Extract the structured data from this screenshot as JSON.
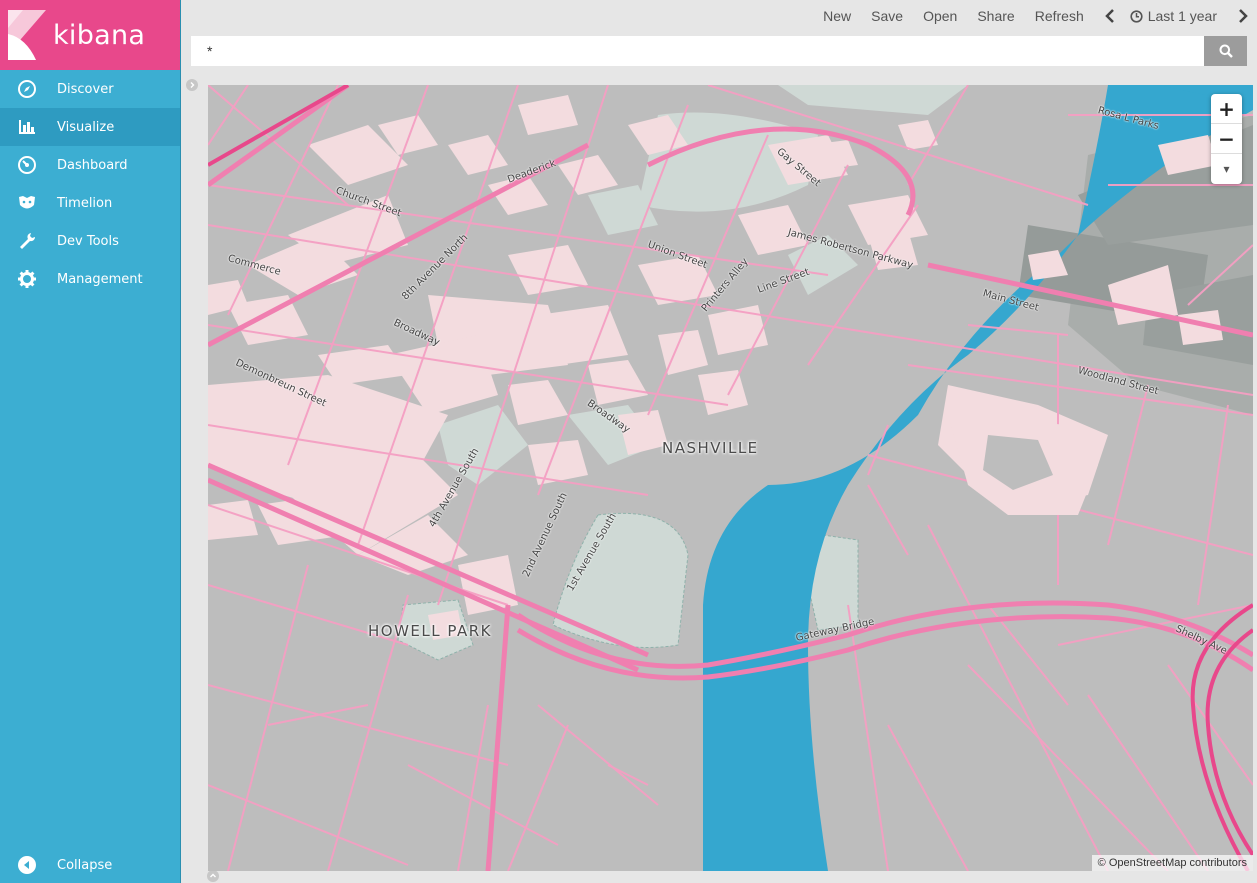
{
  "app": {
    "name": "kibana",
    "brand_color": "#e8488b",
    "sidebar_color": "#3caed2"
  },
  "sidebar": {
    "items": [
      {
        "label": "Discover",
        "icon": "compass-icon"
      },
      {
        "label": "Visualize",
        "icon": "bar-chart-icon",
        "active": true
      },
      {
        "label": "Dashboard",
        "icon": "speedometer-icon"
      },
      {
        "label": "Timelion",
        "icon": "timelion-icon"
      },
      {
        "label": "Dev Tools",
        "icon": "wrench-icon"
      },
      {
        "label": "Management",
        "icon": "gear-icon"
      }
    ],
    "collapse_label": "Collapse"
  },
  "topbar": {
    "new": "New",
    "save": "Save",
    "open": "Open",
    "share": "Share",
    "refresh": "Refresh",
    "time_range": "Last 1 year"
  },
  "search": {
    "value": "*"
  },
  "map": {
    "labels": {
      "nashville": "NASHVILLE",
      "howell_park": "HOWELL PARK"
    },
    "streets": {
      "gateway_bridge": "Gateway Bridge",
      "shelby": "Shelby Ave",
      "woodland": "Woodland Street",
      "main": "Main Street",
      "broadway_1": "Broadway",
      "broadway_2": "Broadway",
      "fourth_ave": "4th Avenue South",
      "second_ave": "2nd Avenue South",
      "first_ave": "1st Avenue South",
      "demonbreun": "Demonbreun Street",
      "union": "Union Street",
      "church": "Church Street",
      "eighth_ave": "8th Avenue North",
      "printers_alley": "Printers Alley",
      "gay_street": "Gay Street",
      "dr": "Rosa L Parks",
      "robertson": "James Robertson Parkway",
      "commerce": "Commerce",
      "deaderick": "Deaderick",
      "line_st": "Line Street"
    },
    "zoom_in": "+",
    "zoom_out": "−",
    "reset_label": "▾",
    "attribution": "© OpenStreetMap contributors",
    "colors": {
      "land": "#bdbdbd",
      "road": "#f59fc3",
      "major_road": "#f07fb0",
      "water": "#35a7cf",
      "park": "#cfd9d5",
      "building": "#f3dcdf"
    }
  }
}
